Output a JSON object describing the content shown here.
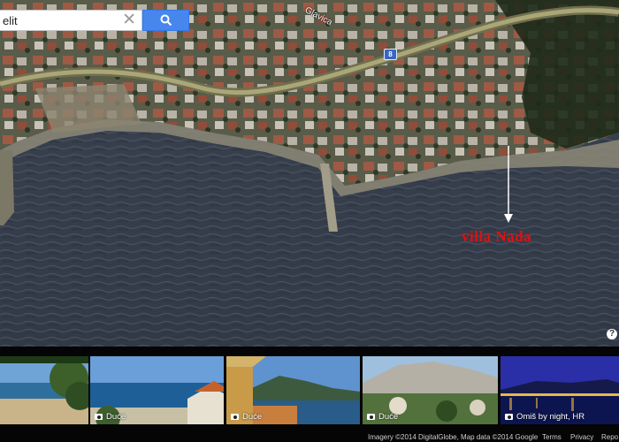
{
  "search": {
    "query": "elit",
    "clear_glyph": "✕"
  },
  "map": {
    "road_number": "8",
    "street_name": "Glavica",
    "marker_label": "villa Nada",
    "marker_color": "#e01010",
    "help_glyph": "?"
  },
  "photos": [
    {
      "label": ""
    },
    {
      "label": "Duće"
    },
    {
      "label": "Duće"
    },
    {
      "label": "Duće"
    },
    {
      "label": "Omiš by night, HR"
    }
  ],
  "footer": {
    "attribution": "Imagery ©2014 DigitalGlobe, Map data ©2014 Google",
    "terms": "Terms",
    "privacy": "Privacy",
    "report": "Repo"
  }
}
